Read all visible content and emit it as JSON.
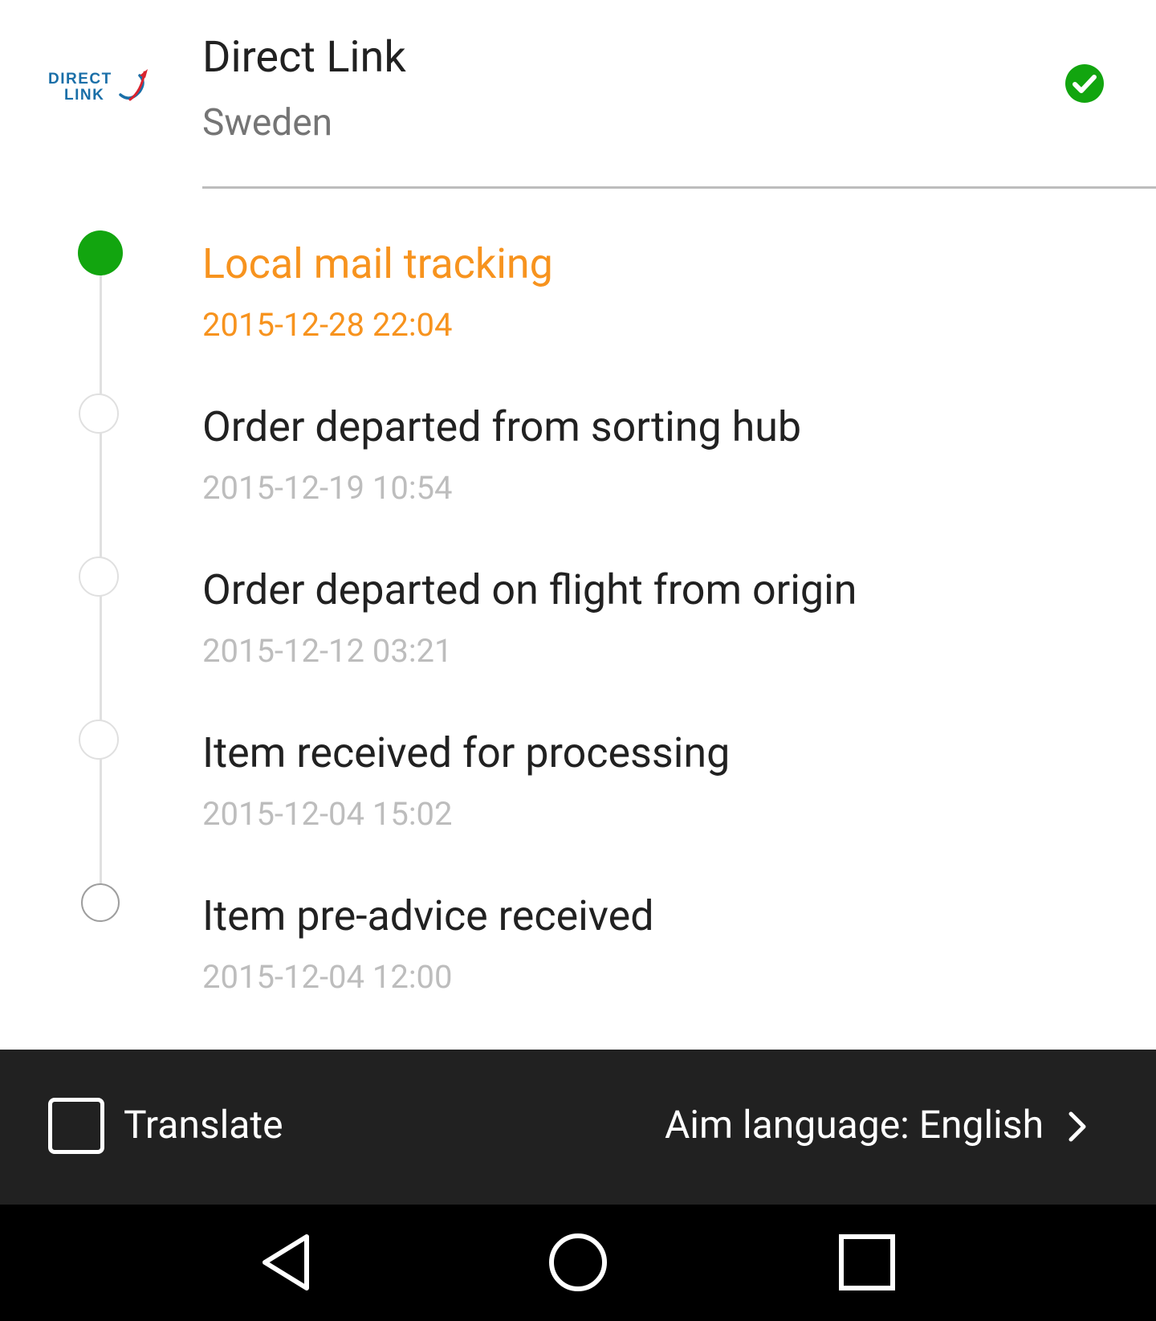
{
  "carrier": {
    "logo_text_line1": "DIRECT",
    "logo_text_line2": "LINK",
    "name": "Direct Link",
    "country": "Sweden",
    "status_icon": "check-circle-icon",
    "status_color": "#12a50f"
  },
  "events": [
    {
      "title": "Local mail tracking",
      "time": "2015-12-28 22:04",
      "current": true
    },
    {
      "title": "Order departed from sorting hub",
      "time": "2015-12-19 10:54",
      "current": false
    },
    {
      "title": "Order departed on flight from origin",
      "time": "2015-12-12 03:21",
      "current": false
    },
    {
      "title": "Item received for processing",
      "time": "2015-12-04 15:02",
      "current": false
    },
    {
      "title": "Item pre-advice received",
      "time": "2015-12-04 12:00",
      "current": false
    }
  ],
  "translate_bar": {
    "checkbox_checked": false,
    "translate_label": "Translate",
    "aim_language_label": "Aim language: English",
    "chevron_icon": "chevron-right-icon"
  },
  "nav_bar": {
    "back_icon": "back-triangle-icon",
    "home_icon": "home-circle-icon",
    "recent_icon": "recent-apps-square-icon"
  },
  "colors": {
    "current_event": "#f7931e",
    "active_dot": "#12a50f",
    "bar_background": "#212121",
    "logo_blue": "#1a6fa8",
    "logo_red": "#d9232e"
  }
}
